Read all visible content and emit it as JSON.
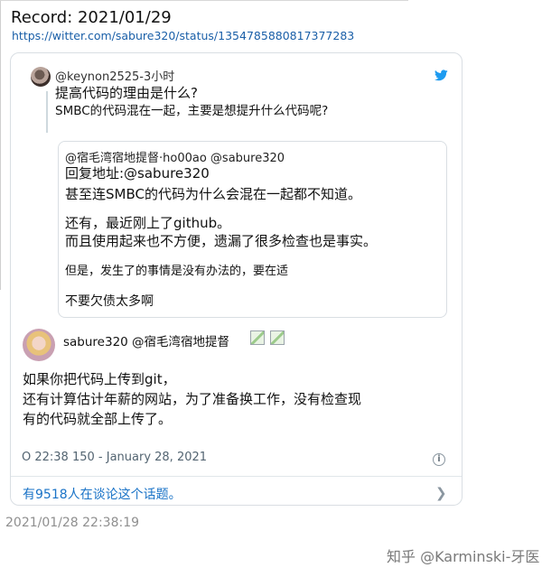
{
  "record": {
    "title": "Record: 2021/01/29",
    "link": "https://witter.com/sabure320/status/1354785880817377283"
  },
  "quoted_tweet": {
    "handle": "@keynon2525-3小时",
    "line1": "提高代码的理由是什么?",
    "line2": "SMBC的代码混在一起，主要是想提升什么代码呢?"
  },
  "inner_tweet": {
    "handle": "@宿毛湾宿地提督·ho00ao @sabure320",
    "reply_to": "回复地址:@sabure320",
    "line2": "甚至连SMBC的代码为什么会混在一起都不知道。",
    "line3": "还有，最近刚上了github。",
    "line4": "而且使用起来也不方便，遗漏了很多检查也是事实。",
    "line5": "但是，发生了的事情是没有办法的，要在适",
    "line6": "不要欠债太多啊"
  },
  "main_tweet": {
    "author": "sabure320 @宿毛湾宿地提督",
    "line1": "如果你把代码上传到git，",
    "line2": "还有计算估计年薪的网站，为了准备换工作，没有检查现",
    "line3": "有的代码就全部上传了。",
    "meta": "O 22:38 150 - January 28, 2021"
  },
  "footer": {
    "discussion": "有9518人在谈论这个话题。"
  },
  "stamp": "2021/01/28 22:38:19",
  "watermark": "知乎 @Karminski-牙医",
  "colors": {
    "link": "#1a73c7",
    "twitter_blue": "#1d9bf0",
    "muted": "#536471"
  },
  "icons": [
    "twitter-bird-icon",
    "info-icon",
    "chevron-right-icon",
    "broken-image-icon"
  ]
}
